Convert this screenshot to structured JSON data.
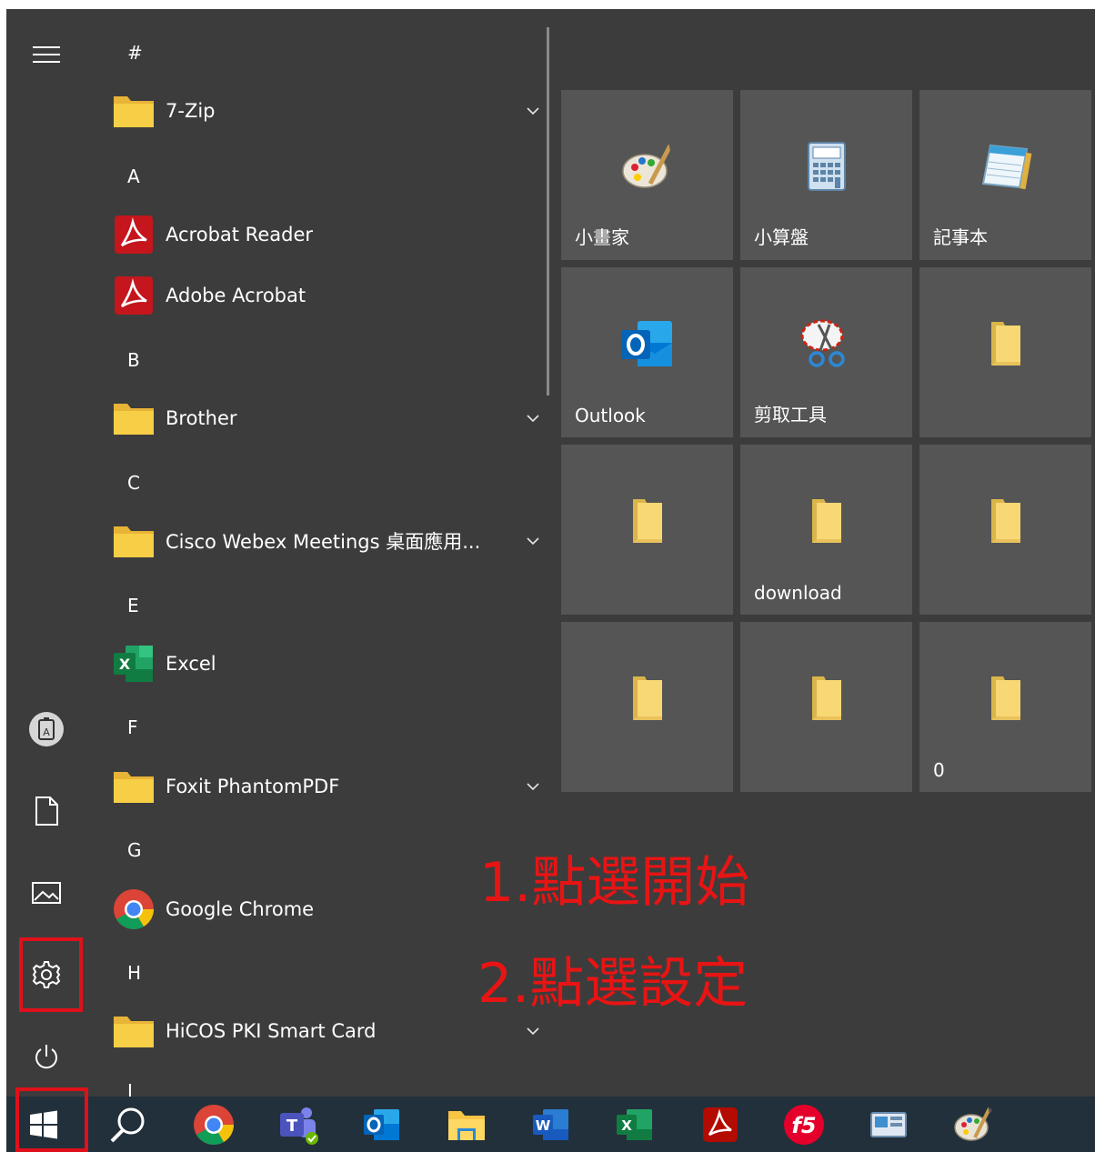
{
  "app_list": [
    {
      "type": "letter",
      "text": "#"
    },
    {
      "type": "app",
      "label": "7-Zip",
      "icon": "folder-icon",
      "expandable": true
    },
    {
      "type": "letter",
      "text": "A"
    },
    {
      "type": "app",
      "label": "Acrobat Reader",
      "icon": "acrobat-icon",
      "expandable": false
    },
    {
      "type": "app",
      "label": "Adobe Acrobat",
      "icon": "acrobat-icon",
      "expandable": false
    },
    {
      "type": "letter",
      "text": "B"
    },
    {
      "type": "app",
      "label": "Brother",
      "icon": "folder-icon",
      "expandable": true
    },
    {
      "type": "letter",
      "text": "C"
    },
    {
      "type": "app",
      "label": "Cisco Webex Meetings 桌面應用...",
      "icon": "folder-icon",
      "expandable": true
    },
    {
      "type": "letter",
      "text": "E"
    },
    {
      "type": "app",
      "label": "Excel",
      "icon": "excel-icon",
      "expandable": false
    },
    {
      "type": "letter",
      "text": "F"
    },
    {
      "type": "app",
      "label": "Foxit PhantomPDF",
      "icon": "folder-icon",
      "expandable": true
    },
    {
      "type": "letter",
      "text": "G"
    },
    {
      "type": "app",
      "label": "Google Chrome",
      "icon": "chrome-icon",
      "expandable": false
    },
    {
      "type": "letter",
      "text": "H"
    },
    {
      "type": "app",
      "label": "HiCOS PKI Smart Card",
      "icon": "folder-icon",
      "expandable": true
    },
    {
      "type": "letter",
      "text": "I"
    }
  ],
  "tiles": [
    {
      "label": "小畫家",
      "icon": "paint-icon"
    },
    {
      "label": "小算盤",
      "icon": "calculator-icon"
    },
    {
      "label": "記事本",
      "icon": "notepad-icon"
    },
    {
      "label": "Outlook",
      "icon": "outlook-icon"
    },
    {
      "label": "剪取工具",
      "icon": "snipping-tool-icon"
    },
    {
      "label": "",
      "icon": "folder-tile-icon"
    },
    {
      "label": "",
      "icon": "folder-tile-icon"
    },
    {
      "label": "download",
      "icon": "folder-tile-icon"
    },
    {
      "label": "",
      "icon": "folder-tile-icon"
    },
    {
      "label": "",
      "icon": "folder-tile-icon"
    },
    {
      "label": "",
      "icon": "folder-tile-icon"
    },
    {
      "label": "0",
      "icon": "folder-tile-icon"
    }
  ],
  "rail": [
    "menu-icon",
    "user-icon",
    "documents-icon",
    "pictures-icon",
    "settings-icon",
    "power-icon"
  ],
  "taskbar": [
    "windows-start-icon",
    "search-icon",
    "chrome-icon",
    "teams-icon",
    "outlook-icon",
    "file-explorer-icon",
    "word-icon",
    "excel-icon",
    "acrobat-icon",
    "f5-icon",
    "control-panel-icon",
    "paint-icon"
  ],
  "annotations": {
    "step1": "1.點選開始",
    "step2": "2.點選設定"
  },
  "colors": {
    "menu_bg": "#3c3c3c",
    "tile_bg": "#555555",
    "taskbar_bg": "#22303b",
    "highlight": "#e0101a",
    "annotation": "#e81414"
  }
}
